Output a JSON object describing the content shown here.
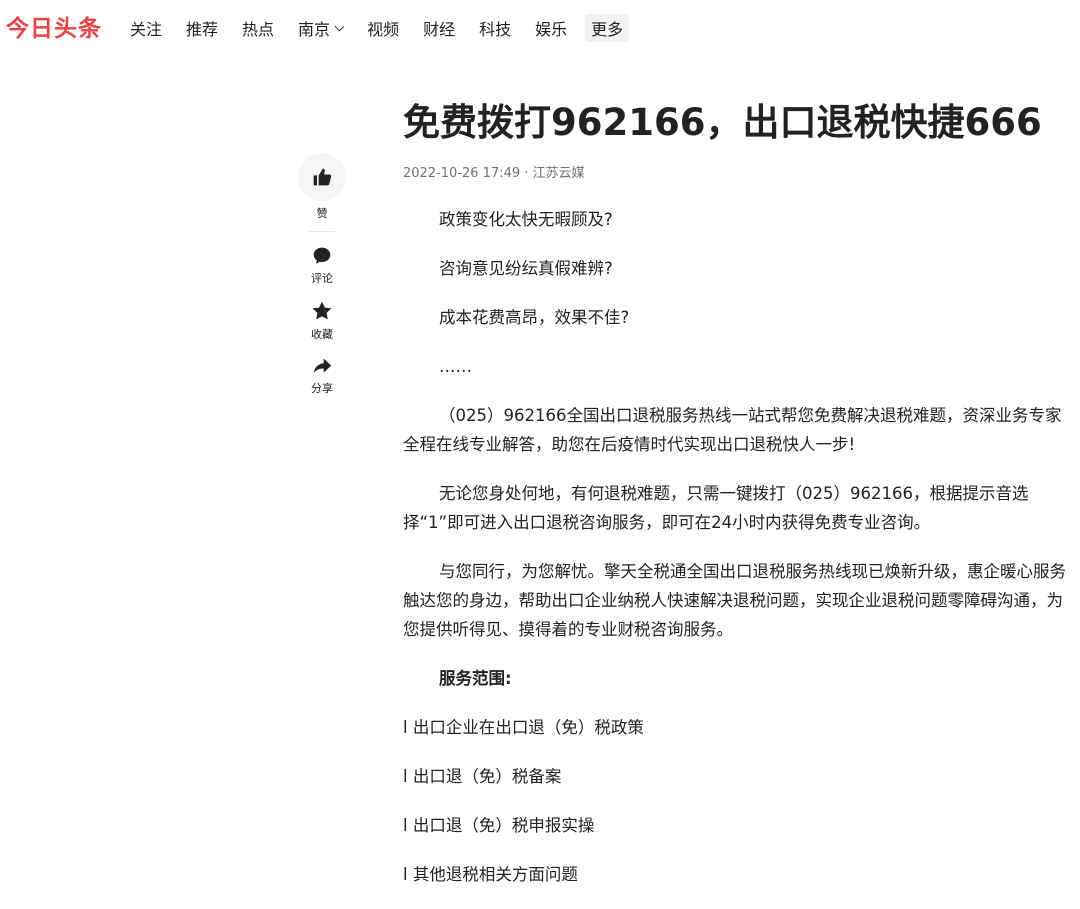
{
  "header": {
    "logo": "今日头条",
    "nav": [
      "关注",
      "推荐",
      "热点",
      "南京",
      "视频",
      "财经",
      "科技",
      "娱乐"
    ],
    "more": "更多",
    "brand_color": "#f04142"
  },
  "rail": {
    "like_label": "赞",
    "comment_label": "评论",
    "favorite_label": "收藏",
    "share_label": "分享"
  },
  "article": {
    "title": "免费拨打962166，出口退税快捷666",
    "meta": "2022-10-26 17:49 · 江苏云媒",
    "paragraphs": [
      "政策变化太快无暇顾及?",
      "咨询意见纷纭真假难辨?",
      "成本花费高昂，效果不佳?",
      "……",
      "（025）962166全国出口退税服务热线一站式帮您免费解决退税难题，资深业务专家全程在线专业解答，助您在后疫情时代实现出口退税快人一步!",
      "无论您身处何地，有何退税难题，只需一键拨打（025）962166，根据提示音选择“1”即可进入出口退税咨询服务，即可在24小时内获得免费专业咨询。",
      "与您同行，为您解忧。擎天全税通全国出口退税服务热线现已焕新升级，惠企暖心服务触达您的身边，帮助出口企业纳税人快速解决退税问题，实现企业退税问题零障碍沟通，为您提供听得见、摸得着的专业财税咨询服务。"
    ],
    "service_title": "服务范围:",
    "service_items": [
      "l 出口企业在出口退（免）税政策",
      "l 出口退（免）税备案",
      "l 出口退（免）税申报实操",
      "l 其他退税相关方面问题"
    ]
  }
}
